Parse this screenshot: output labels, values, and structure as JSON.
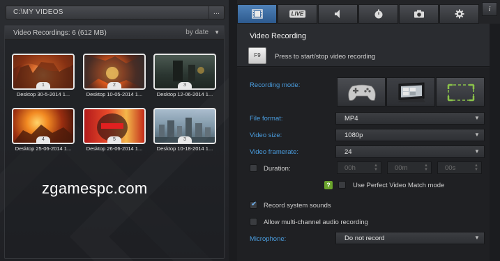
{
  "left": {
    "path": "C:\\MY VIDEOS",
    "more_label": "...",
    "recordings_title": "Video Recordings: 6 (612 MB)",
    "sort_label": "by date",
    "sort_arrow": "▼",
    "thumbnails": [
      {
        "caption": "Desktop 30-5-2014 1...",
        "number": "1"
      },
      {
        "caption": "Desktop 10-05-2014 1...",
        "number": "2"
      },
      {
        "caption": "Desktop 12-06-2014 1...",
        "number": "3"
      },
      {
        "caption": "Desktop 25-06-2014 1...",
        "number": "4"
      },
      {
        "caption": "Desktop 26-06-2014 1...",
        "number": "5"
      },
      {
        "caption": "Desktop 10-18-2014 1...",
        "number": "3"
      }
    ],
    "watermark": "zgamespc.com"
  },
  "tabs": [
    {
      "name": "video",
      "icon": "film-icon",
      "glyph": "▣"
    },
    {
      "name": "live",
      "icon": "live-icon",
      "glyph": "LIVE"
    },
    {
      "name": "audio",
      "icon": "speaker-icon",
      "glyph": "◀"
    },
    {
      "name": "benchmark",
      "icon": "stopwatch-icon",
      "glyph": "◷"
    },
    {
      "name": "screenshot",
      "icon": "camera-icon",
      "glyph": "◙"
    },
    {
      "name": "settings",
      "icon": "gear-icon",
      "glyph": "✲"
    }
  ],
  "info_label": "i",
  "video_recording": {
    "title": "Video Recording",
    "hotkey": "F9",
    "hotkey_desc": "Press to start/stop video recording"
  },
  "settings": {
    "recording_mode_label": "Recording mode:",
    "file_format_label": "File format:",
    "file_format_value": "MP4",
    "video_size_label": "Video size:",
    "video_size_value": "1080p",
    "video_framerate_label": "Video framerate:",
    "video_framerate_value": "24",
    "duration_label": "Duration:",
    "duration_hours": "00h",
    "duration_minutes": "00m",
    "duration_seconds": "00s",
    "help_glyph": "?",
    "perfect_match_label": "Use Perfect Video Match mode",
    "record_sounds_label": "Record system sounds",
    "multichannel_label": "Allow multi-channel audio recording",
    "microphone_label": "Microphone:",
    "microphone_value": "Do not record",
    "dropdown_arrow": "▼",
    "spin_arrows": "▲▼"
  },
  "colors": {
    "accent_blue": "#4a9ddf",
    "active_tab": "#3f72ab",
    "help_green": "#6aa42c"
  }
}
